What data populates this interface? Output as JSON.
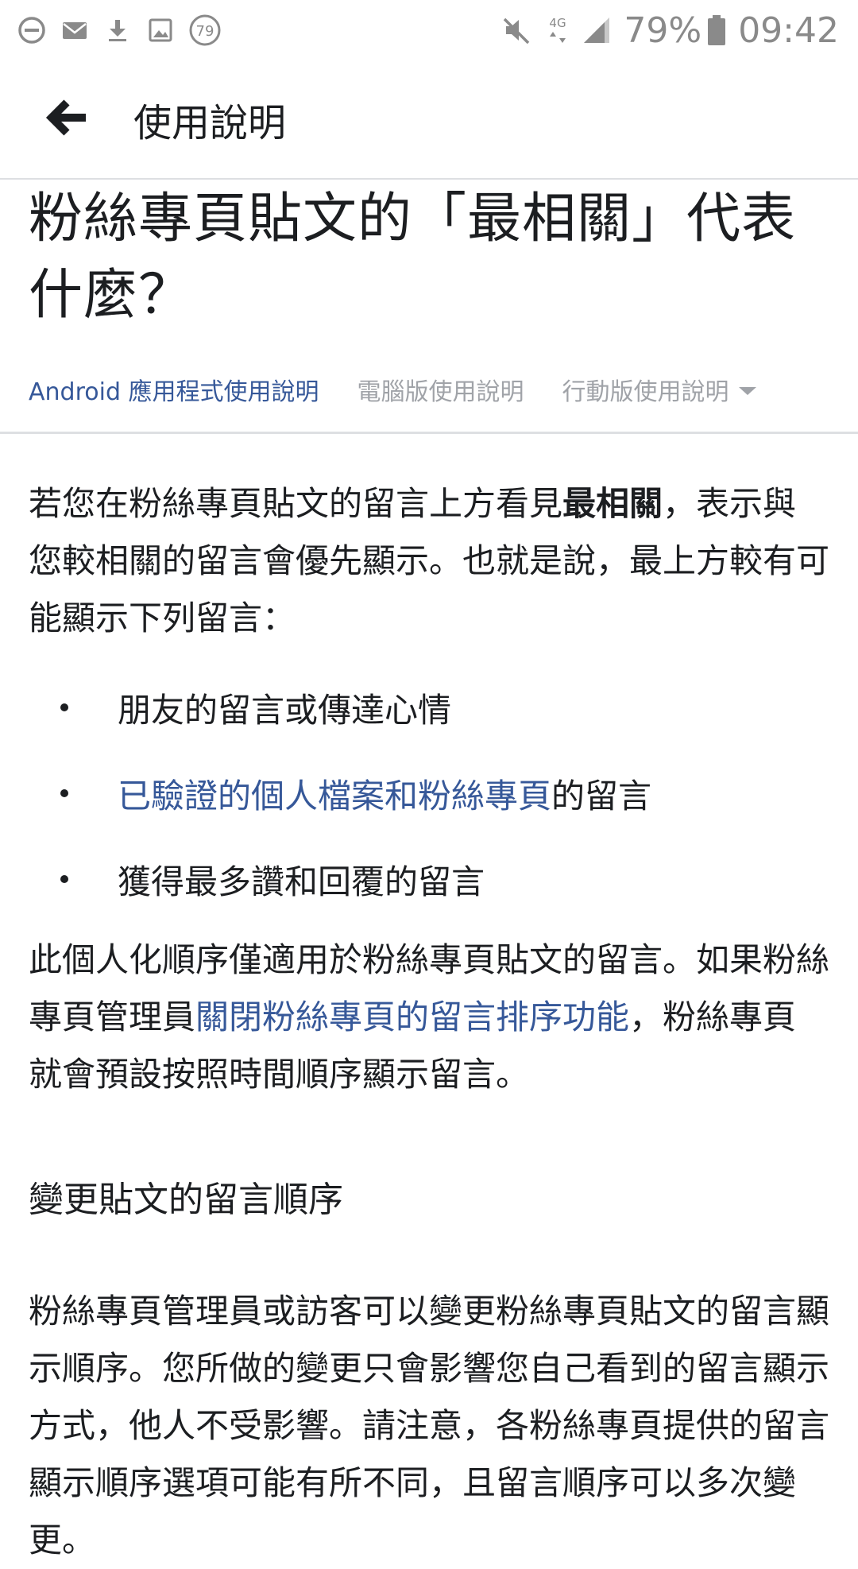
{
  "status_bar": {
    "left_icons": [
      "do-not-disturb-icon",
      "mail-icon",
      "download-icon",
      "image-icon",
      "notification-count-icon"
    ],
    "notification_count": "79",
    "network_label": "4G",
    "battery_percent": "79%",
    "time": "09:42"
  },
  "app_bar": {
    "back_icon": "arrow-left-icon",
    "title": "使用說明"
  },
  "article": {
    "title": "粉絲專頁貼文的「最相關」代表什麼？",
    "tabs": [
      {
        "label": "Android 應用程式使用說明",
        "active": true
      },
      {
        "label": "電腦版使用說明",
        "active": false
      },
      {
        "label": "行動版使用說明",
        "active": false,
        "has_dropdown": true
      }
    ],
    "paragraph1": {
      "before": "若您在粉絲專頁貼文的留言上方看見",
      "bold": "最相關",
      "after": "，表示與您較相關的留言會優先顯示。也就是說，最上方較有可能顯示下列留言："
    },
    "bullets": [
      {
        "text": "朋友的留言或傳達心情"
      },
      {
        "link": "已驗證的個人檔案和粉絲專頁",
        "text": "的留言"
      },
      {
        "text": "獲得最多讚和回覆的留言"
      }
    ],
    "paragraph2": {
      "before": "此個人化順序僅適用於粉絲專頁貼文的留言。如果粉絲專頁管理員",
      "link": "關閉粉絲專頁的留言排序功能",
      "after": "，粉絲專頁就會預設按照時間順序顯示留言。"
    },
    "section_heading": "變更貼文的留言順序",
    "paragraph3": "粉絲專頁管理員或訪客可以變更粉絲專頁貼文的留言顯示順序。您所做的變更只會影響您自己看到的留言顯示方式，他人不受影響。請注意，各粉絲專頁提供的留言顯示順序選項可能有所不同，且留言順序可以多次變更。"
  },
  "colors": {
    "link": "#365899",
    "text": "#1c1e21",
    "muted_tab": "#a0a3a8",
    "status_icons": "#8a8a8a"
  }
}
